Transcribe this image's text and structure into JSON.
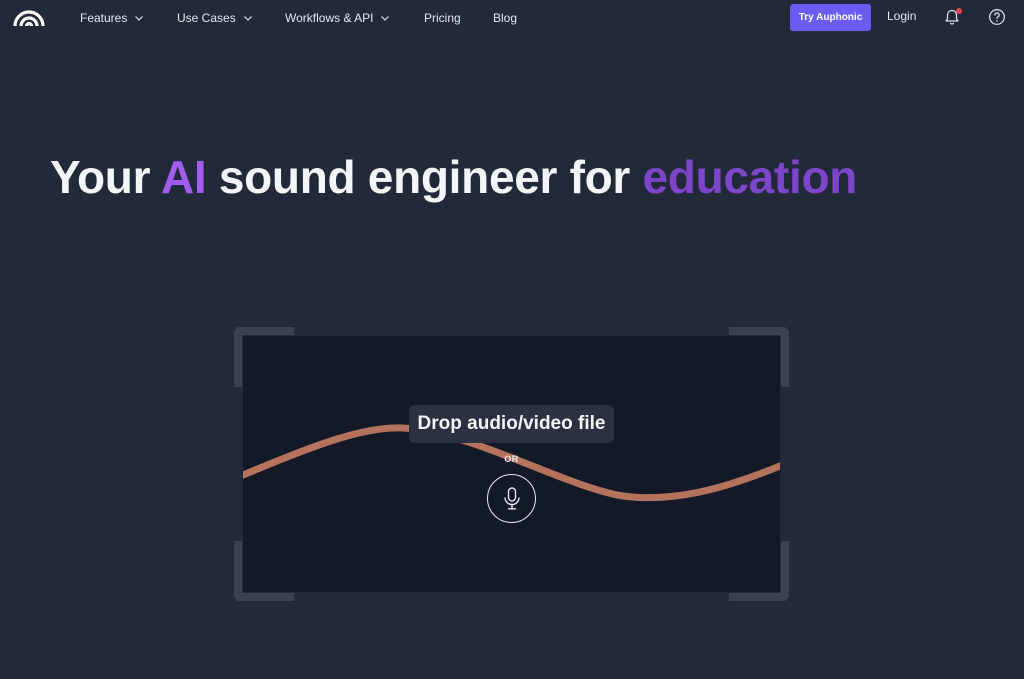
{
  "nav": {
    "logo_icon": "auphonic-arc-logo-icon",
    "items": [
      {
        "label": "Features",
        "has_dropdown": true
      },
      {
        "label": "Use Cases",
        "has_dropdown": true
      },
      {
        "label": "Workflows & API",
        "has_dropdown": true
      },
      {
        "label": "Pricing",
        "has_dropdown": false
      },
      {
        "label": "Blog",
        "has_dropdown": false
      }
    ],
    "try_button": "Try Auphonic",
    "login": "Login",
    "notification_icon": "bell-icon",
    "help_icon": "question-circle-icon"
  },
  "hero": {
    "title_part1": "Your ",
    "title_ai": "AI",
    "title_part2": " sound engineer for ",
    "title_topic": "education"
  },
  "dropzone": {
    "label": "Drop audio/video file",
    "or": "OR",
    "mic_icon": "microphone-icon"
  },
  "colors": {
    "background": "#222938",
    "dropzone_bg": "#141927",
    "accent_button": "#6b5cf6",
    "accent_ai": "#a35cf0",
    "accent_topic": "#7b46c9",
    "wave": "#b5735e",
    "notification_dot": "#ef4444"
  }
}
